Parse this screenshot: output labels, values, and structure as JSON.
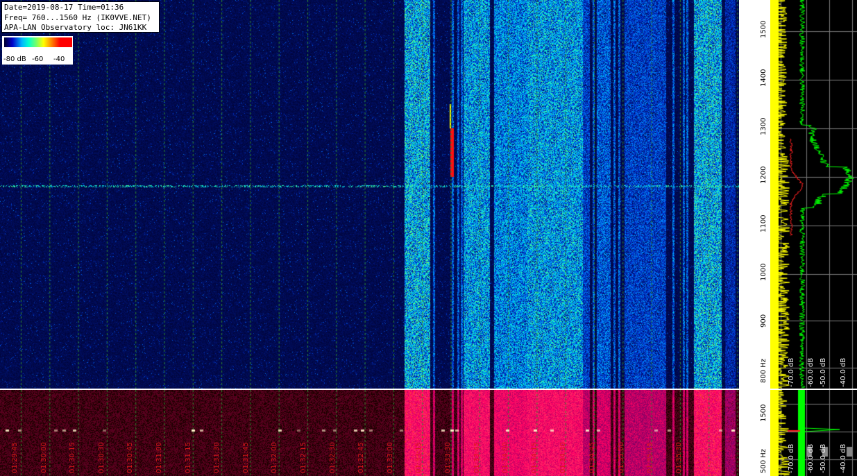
{
  "header": {
    "line1": "Date=2019-08-17 Time=01:36",
    "line2": "Freq= 760...1560 Hz (IK0VVE.NET)",
    "line3": "APA-LAN Observatory loc: JN61KK"
  },
  "colorbar": {
    "labels": [
      "-80 dB",
      "-60",
      "-40"
    ]
  },
  "freq_scale": {
    "labels": [
      "1500",
      "1400",
      "1300",
      "1200",
      "1100",
      "1000",
      "900",
      "800 Hz"
    ]
  },
  "bottom_freq_scale": {
    "labels": [
      "1500",
      "500 Hz"
    ]
  },
  "time_axis": {
    "labels": [
      "01:29:45",
      "01:30:00",
      "01:30:15",
      "01:30:30",
      "01:30:45",
      "01:31:00",
      "01:31:15",
      "01:31:30",
      "01:31:45",
      "01:32:00",
      "01:32:15",
      "01:32:30",
      "01:32:45",
      "01:33:00",
      "01:33:15",
      "01:33:30",
      "01:33:45",
      "01:34:00",
      "01:34:15",
      "01:34:30",
      "01:34:45",
      "01:35:00",
      "01:35:15",
      "01:35:30"
    ]
  },
  "spectrum_scale": {
    "labels": [
      "-70.0 dB",
      "-60.0 dB",
      "-50.0 dB",
      "-40.0 dB"
    ]
  },
  "colors": {
    "grid_time": "#2e8b2e",
    "grid_spec": "#7a7a7a",
    "avg_trace": "#ffff00",
    "peak_trace": "#00ff00",
    "signal_trace": "#ff2020",
    "time_label": "#d81818"
  },
  "icons": [
    "colorbar-gradient",
    "waterfall-spectrogram",
    "spectrum-trace"
  ]
}
